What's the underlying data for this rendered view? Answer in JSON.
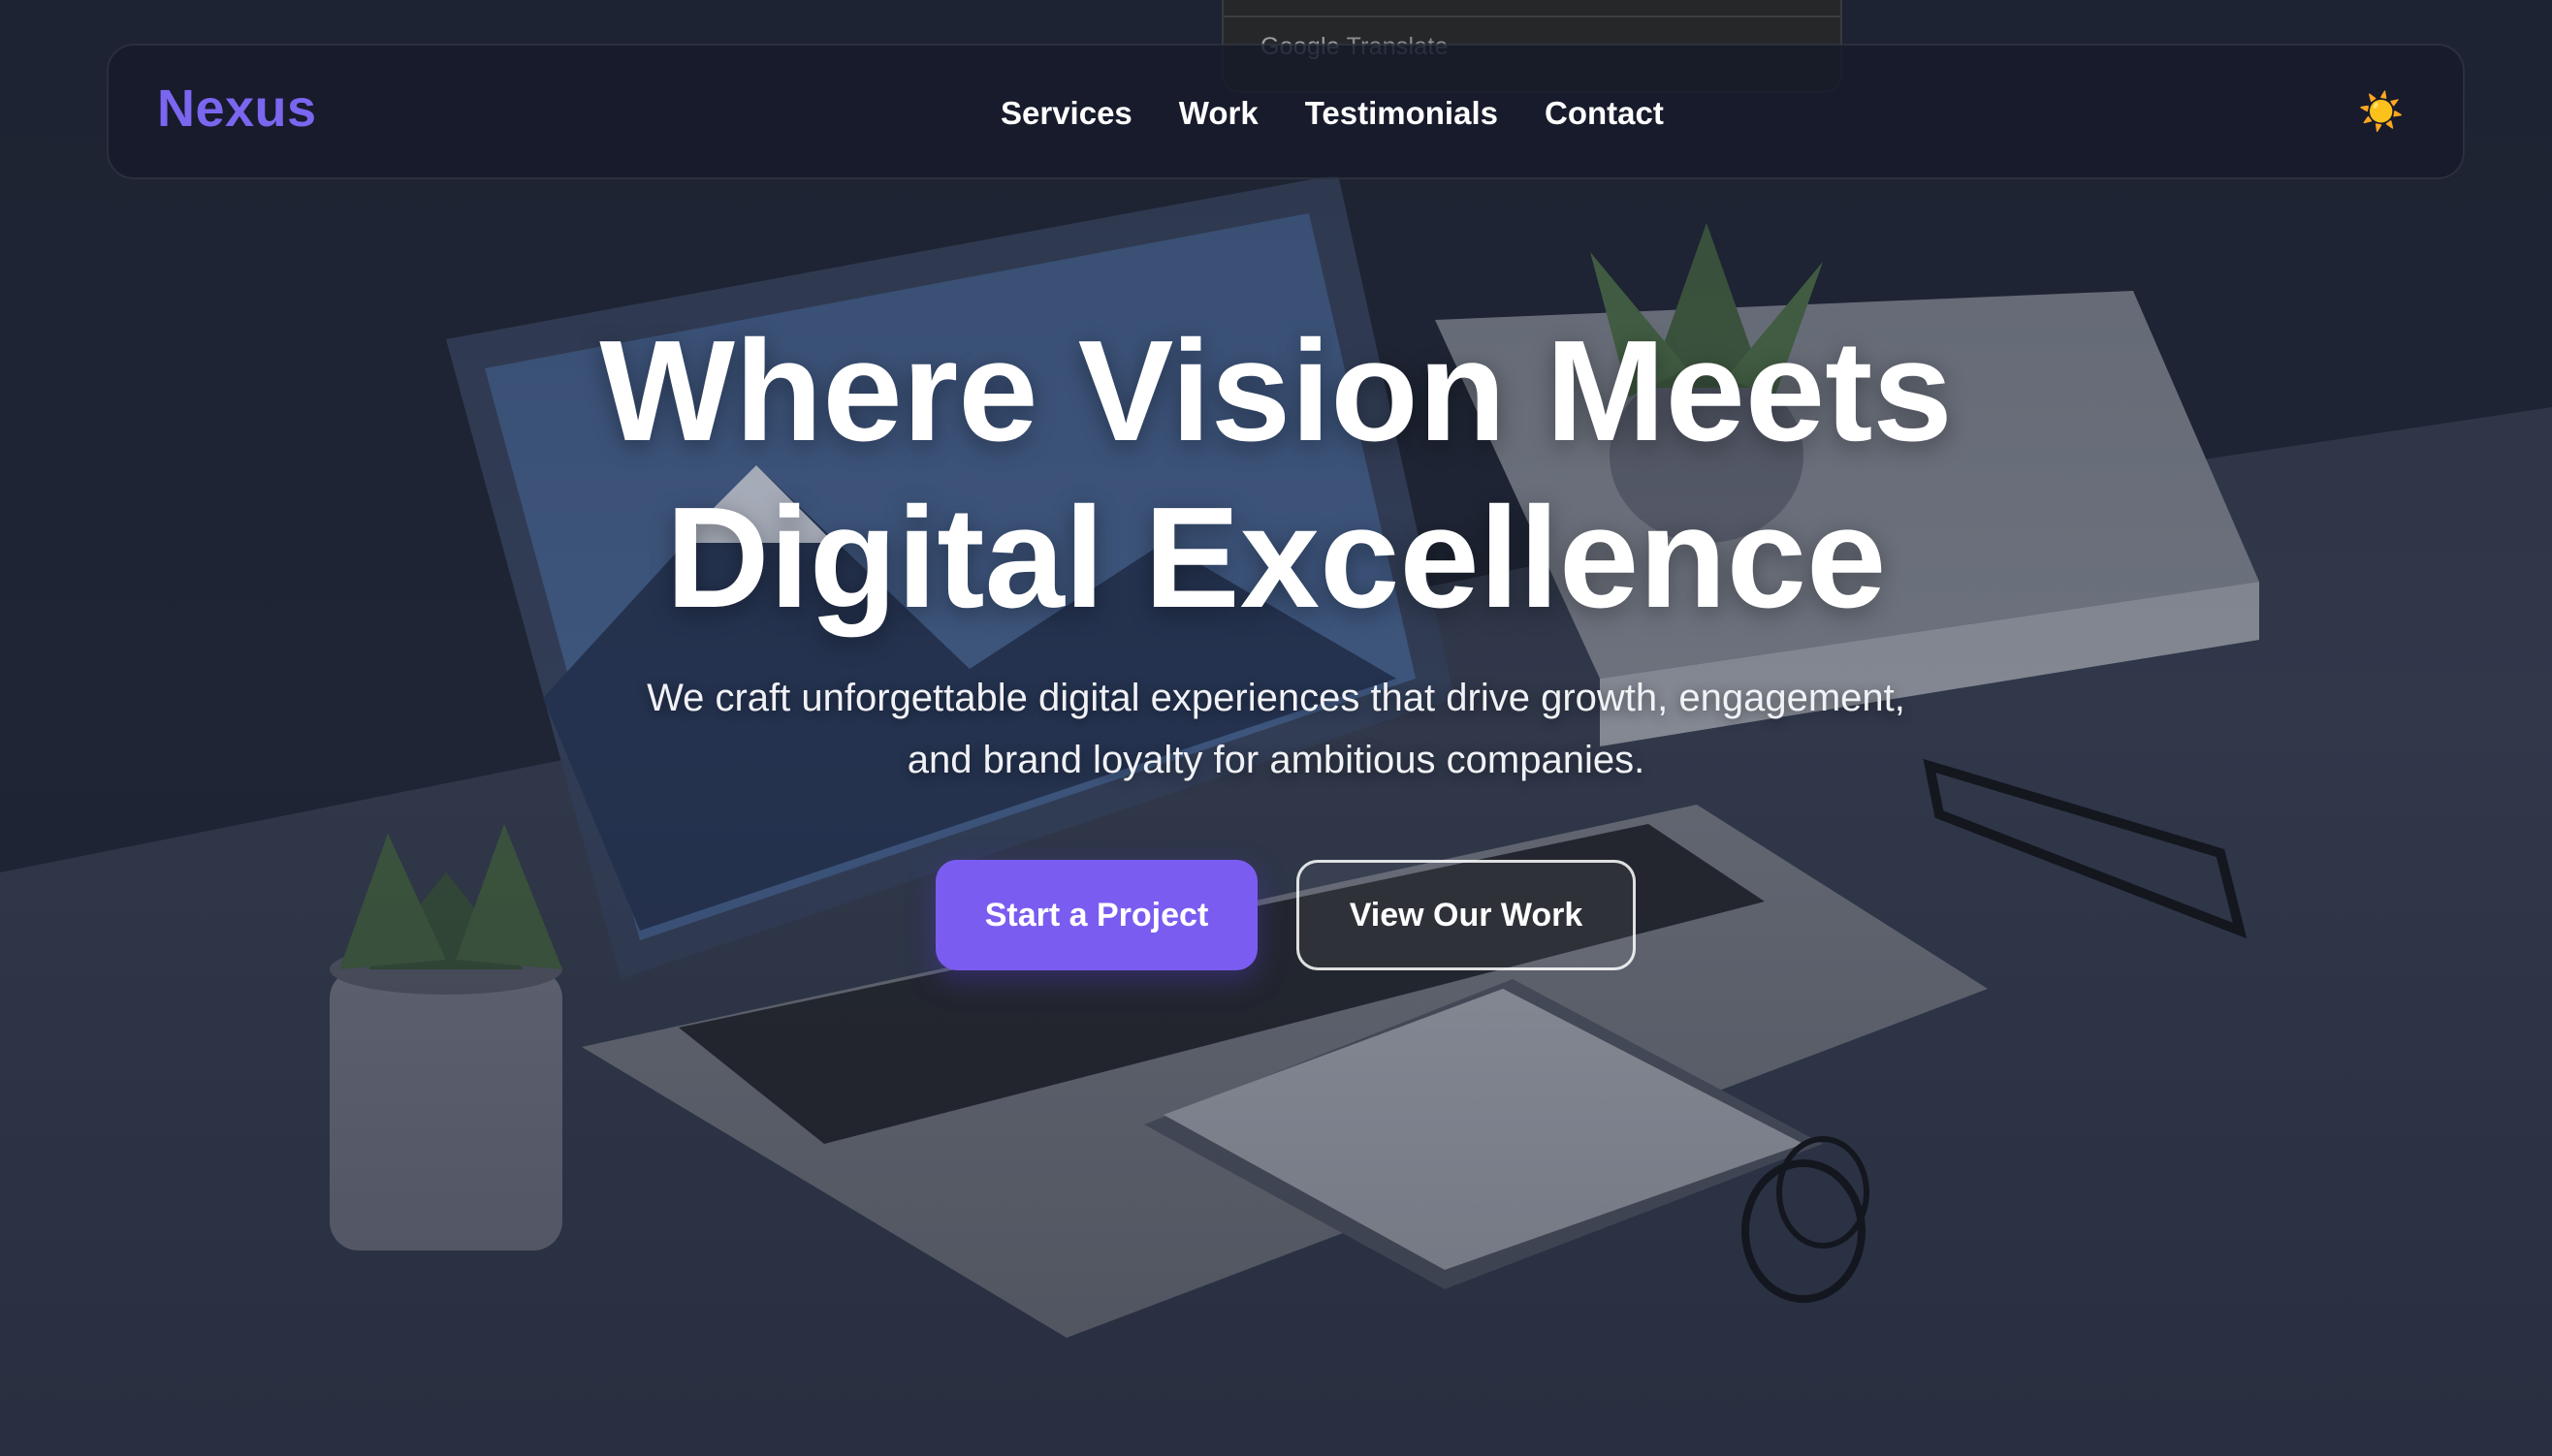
{
  "translate_bar": {
    "brand": "Google",
    "label": "Translate"
  },
  "nav": {
    "logo": "Nexus",
    "links": [
      "Services",
      "Work",
      "Testimonials",
      "Contact"
    ],
    "theme_icon": "sun-icon"
  },
  "hero": {
    "headline_line1": "Where Vision Meets",
    "headline_line2": "Digital Excellence",
    "subtitle_line1": "We craft unforgettable digital experiences that drive growth, engagement,",
    "subtitle_line2": "and brand loyalty for ambitious companies.",
    "primary_cta": "Start a Project",
    "secondary_cta": "View Our Work"
  },
  "colors": {
    "accent": "#7b5cf0",
    "logo": "#7b66f0",
    "nav_bg": "#161a2a",
    "text": "#ffffff"
  }
}
